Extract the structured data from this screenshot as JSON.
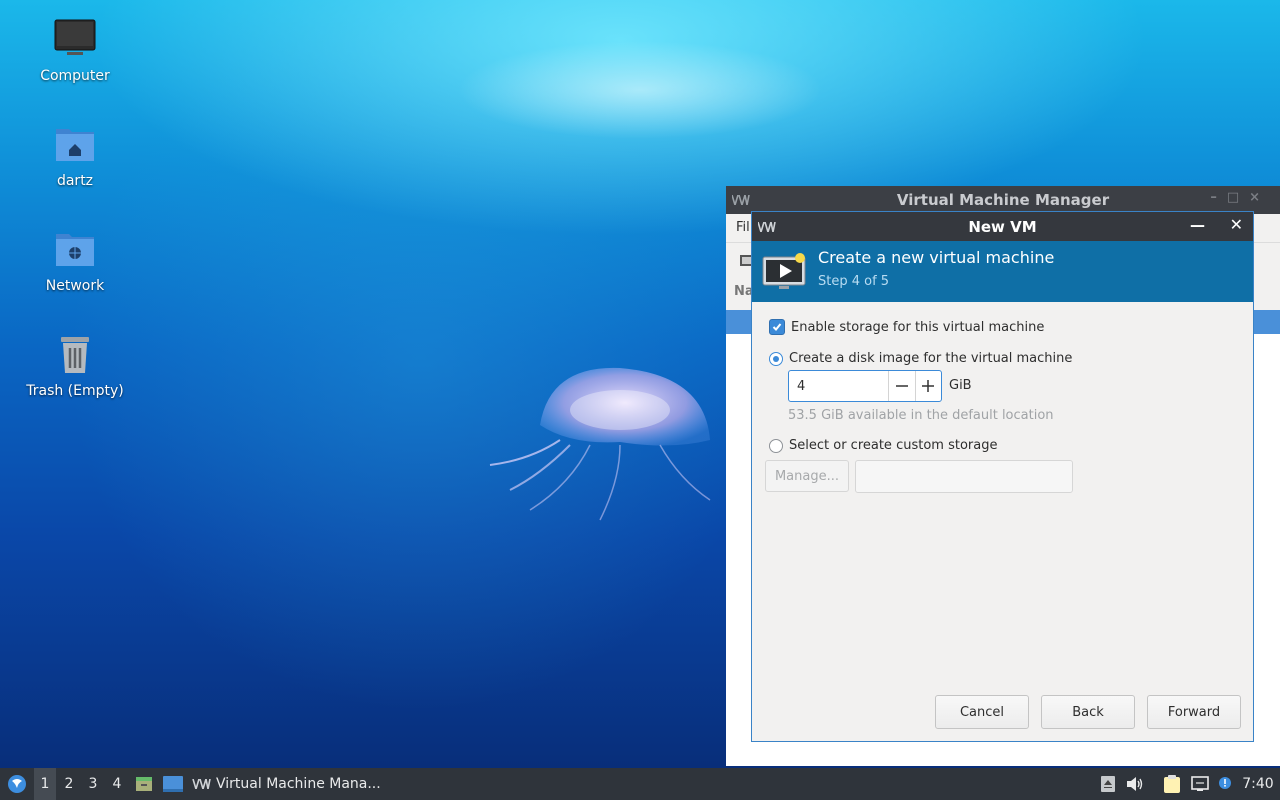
{
  "desktop": {
    "icons": [
      {
        "label": "Computer",
        "icon": "computer-icon"
      },
      {
        "label": "dartz",
        "icon": "home-folder-icon"
      },
      {
        "label": "Network",
        "icon": "network-folder-icon"
      },
      {
        "label": "Trash (Empty)",
        "icon": "trash-icon"
      }
    ]
  },
  "bg_window": {
    "title": "Virtual Machine Manager",
    "menu_partial": "Fil",
    "header_partial": "Na"
  },
  "dialog": {
    "title": "New VM",
    "banner_title": "Create a new virtual machine",
    "banner_step": "Step 4 of 5",
    "enable_storage_label": "Enable storage for this virtual machine",
    "enable_storage_checked": true,
    "create_disk_label": "Create a disk image for the virtual machine",
    "disk_size_value": "4",
    "disk_size_unit": "GiB",
    "available_text": "53.5 GiB available in the default location",
    "custom_storage_label": "Select or create custom storage",
    "manage_label": "Manage...",
    "custom_path_value": "",
    "cancel_label": "Cancel",
    "back_label": "Back",
    "forward_label": "Forward"
  },
  "taskbar": {
    "workspaces": [
      "1",
      "2",
      "3",
      "4"
    ],
    "active_workspace": "1",
    "task_label": "Virtual Machine Mana...",
    "clock": "7:40"
  },
  "colors": {
    "banner": "#0f6fa6",
    "accent": "#3b8ad8",
    "titlebar": "#35383e",
    "taskbar": "#2f343b"
  }
}
